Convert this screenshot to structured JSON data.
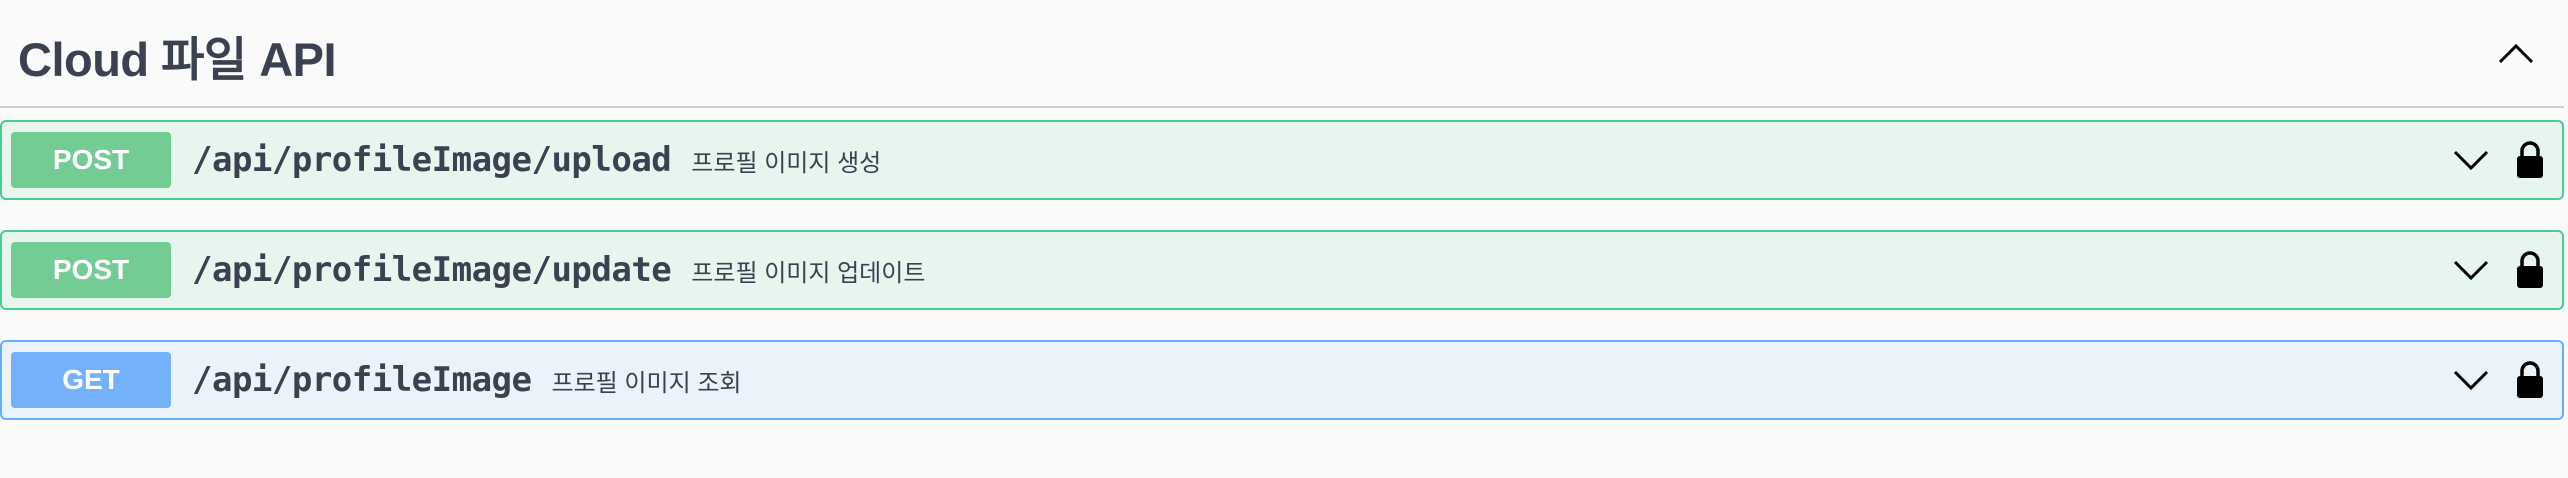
{
  "section": {
    "title": "Cloud 파일 API",
    "collapse_icon": "chevron-up-icon"
  },
  "operations": [
    {
      "method": "POST",
      "path": "/api/profileImage/upload",
      "summary": "프로필 이미지 생성",
      "color": "#49cc90"
    },
    {
      "method": "POST",
      "path": "/api/profileImage/update",
      "summary": "프로필 이미지 업데이트",
      "color": "#49cc90"
    },
    {
      "method": "GET",
      "path": "/api/profileImage",
      "summary": "프로필 이미지 조회",
      "color": "#61affe"
    }
  ],
  "icons": {
    "expand": "chevron-down-icon",
    "auth": "lock-icon"
  }
}
